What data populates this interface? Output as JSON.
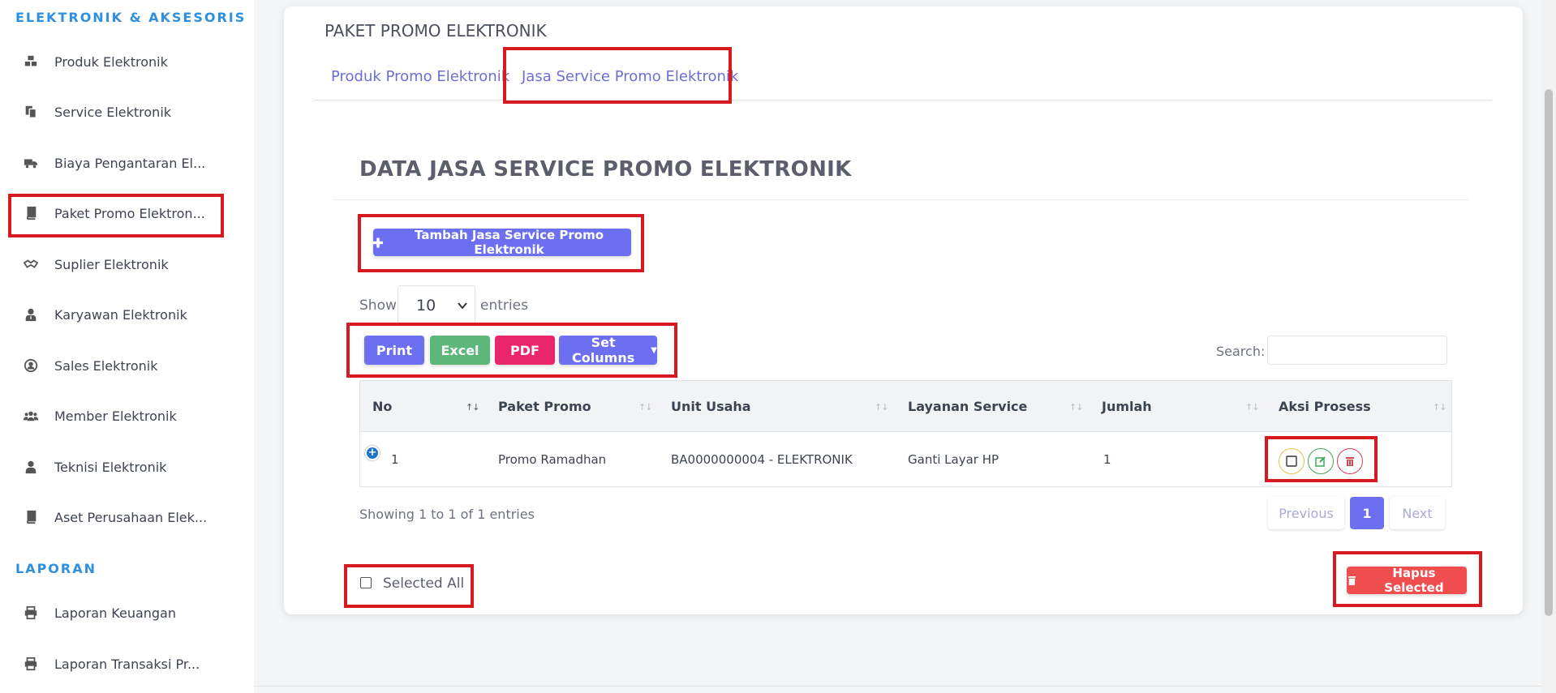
{
  "sidebar": {
    "section1_title": "ELEKTRONIK & AKSESORIS",
    "items": [
      {
        "label": "Produk Elektronik",
        "icon": "cubes-icon"
      },
      {
        "label": "Service Elektronik",
        "icon": "copy-icon"
      },
      {
        "label": "Biaya Pengantaran El...",
        "icon": "truck-icon"
      },
      {
        "label": "Paket Promo Elektron...",
        "icon": "book-icon"
      },
      {
        "label": "Suplier Elektronik",
        "icon": "handshake-icon"
      },
      {
        "label": "Karyawan Elektronik",
        "icon": "user-tie-icon"
      },
      {
        "label": "Sales Elektronik",
        "icon": "user-circle-icon"
      },
      {
        "label": "Member Elektronik",
        "icon": "users-icon"
      },
      {
        "label": "Teknisi Elektronik",
        "icon": "user-icon"
      },
      {
        "label": "Aset Perusahaan Elek...",
        "icon": "book-icon"
      }
    ],
    "section2_title": "LAPORAN",
    "report_items": [
      {
        "label": "Laporan Keuangan",
        "icon": "print-icon"
      },
      {
        "label": "Laporan Transaksi Pr...",
        "icon": "print-icon"
      }
    ]
  },
  "card": {
    "title": "PAKET PROMO ELEKTRONIK",
    "tabs": [
      "Produk Promo Elektronik",
      "Jasa Service Promo Elektronik"
    ],
    "active_tab": 1,
    "section_title": "DATA JASA SERVICE PROMO ELEKTRONIK",
    "add_button": "Tambah Jasa Service Promo Elektronik",
    "show_label": "Show",
    "entries_value": "10",
    "entries_label": "entries",
    "export_buttons": {
      "print": "Print",
      "excel": "Excel",
      "pdf": "PDF",
      "set_columns": "Set Columns"
    },
    "search_label": "Search:",
    "search_value": "",
    "table": {
      "headers": [
        "No",
        "Paket Promo",
        "Unit Usaha",
        "Layanan Service",
        "Jumlah",
        "Aksi Prosess"
      ],
      "rows": [
        {
          "no": "1",
          "paket_promo": "Promo Ramadhan",
          "unit_usaha": "BA0000000004 - ELEKTRONIK",
          "layanan_service": "Ganti Layar HP",
          "jumlah": "1"
        }
      ]
    },
    "info": "Showing 1 to 1 of 1 entries",
    "pagination": {
      "previous": "Previous",
      "current": "1",
      "next": "Next"
    },
    "selected_all": "Selected All",
    "delete_button": "Hapus Selected"
  },
  "colors": {
    "accent": "#6c6ff0",
    "sidebar_heading": "#2f8fe0",
    "highlight_box": "#d61a1f",
    "excel": "#5bb77a",
    "pdf": "#e9256b",
    "danger": "#f04e4e"
  }
}
